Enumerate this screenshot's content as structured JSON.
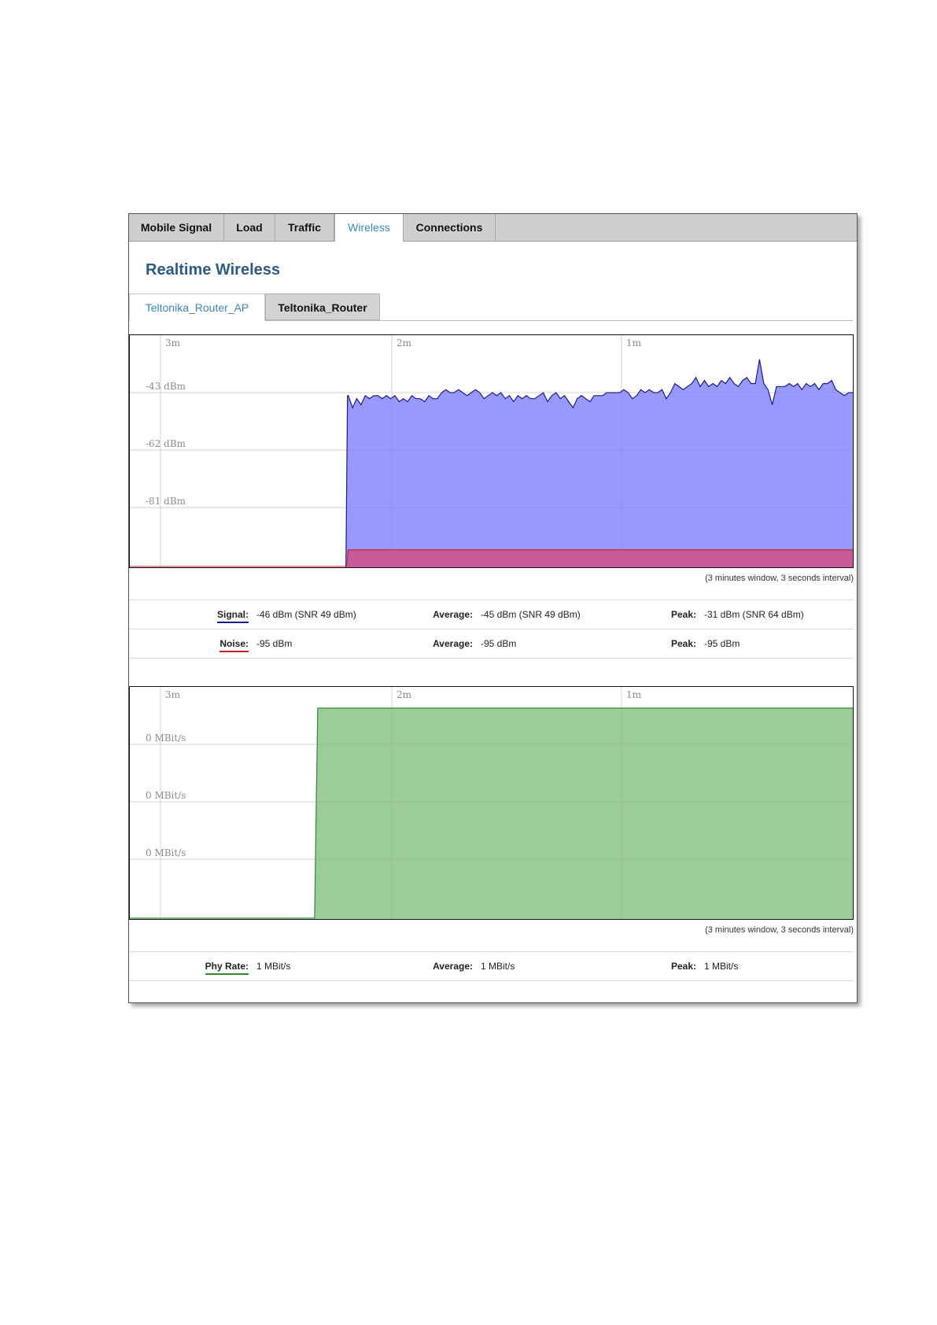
{
  "tabs": [
    {
      "label": "Mobile Signal",
      "active": false
    },
    {
      "label": "Load",
      "active": false
    },
    {
      "label": "Traffic",
      "active": false
    },
    {
      "label": "Wireless",
      "active": true
    },
    {
      "label": "Connections",
      "active": false
    }
  ],
  "page_title": "Realtime Wireless",
  "subtabs": [
    {
      "label": "Teltonika_Router_AP",
      "active": true
    },
    {
      "label": "Teltonika_Router",
      "active": false
    }
  ],
  "colors": {
    "signal_fill": "#9898ff",
    "signal_line": "#1a1a8a",
    "noise_fill": "#c85a98",
    "noise_line": "#c0202a",
    "rate_fill": "#9ccc98",
    "rate_line": "#2e8b2e",
    "grid": "#e6e6e6",
    "tab_active_text": "#3a86b6",
    "title": "#2d5b86"
  },
  "signal_chart": {
    "time_labels": [
      "3m",
      "2m",
      "1m"
    ],
    "y_labels": [
      "-43 dBm",
      "-62 dBm",
      "-81 dBm"
    ],
    "window_note": "(3 minutes window, 3 seconds interval)",
    "stats": [
      {
        "label": "Signal:",
        "value": "-46 dBm (SNR 49 dBm)",
        "avg_label": "Average:",
        "avg_value": "-45 dBm (SNR 49 dBm)",
        "peak_label": "Peak:",
        "peak_value": "-31 dBm (SNR 64 dBm)"
      },
      {
        "label": "Noise:",
        "value": "-95 dBm",
        "avg_label": "Average:",
        "avg_value": "-95 dBm",
        "peak_label": "Peak:",
        "peak_value": "-95 dBm"
      }
    ]
  },
  "rate_chart": {
    "time_labels": [
      "3m",
      "2m",
      "1m"
    ],
    "y_labels": [
      "0 MBit/s",
      "0 MBit/s",
      "0 MBit/s"
    ],
    "window_note": "(3 minutes window, 3 seconds interval)",
    "stats": [
      {
        "label": "Phy Rate:",
        "value": "1 MBit/s",
        "avg_label": "Average:",
        "avg_value": "1 MBit/s",
        "peak_label": "Peak:",
        "peak_value": "1 MBit/s"
      }
    ]
  },
  "chart_data": [
    {
      "type": "area",
      "x_unit": "seconds ago",
      "x_range": [
        180,
        0
      ],
      "series": [
        {
          "name": "Signal",
          "unit": "dBm",
          "start_seconds_ago": 126,
          "values": [
            -44,
            -48,
            -45,
            -47,
            -44,
            -45,
            -44,
            -44,
            -45,
            -44,
            -45,
            -44,
            -46,
            -45,
            -46,
            -44,
            -45,
            -45,
            -46,
            -44,
            -45,
            -45,
            -43,
            -42,
            -43,
            -43,
            -42,
            -43,
            -44,
            -43,
            -42,
            -43,
            -45,
            -44,
            -43,
            -44,
            -43,
            -45,
            -44,
            -46,
            -44,
            -45,
            -44,
            -45,
            -45,
            -44,
            -43,
            -46,
            -44,
            -43,
            -45,
            -44,
            -46,
            -48,
            -45,
            -44,
            -45,
            -46,
            -44,
            -44,
            -44,
            -43,
            -43,
            -43,
            -43,
            -42,
            -43,
            -45,
            -44,
            -42,
            -43,
            -42,
            -43,
            -43,
            -42,
            -45,
            -43,
            -40,
            -41,
            -42,
            -41,
            -40,
            -38,
            -41,
            -39,
            -41,
            -40,
            -41,
            -39,
            -40,
            -38,
            -40,
            -41,
            -39,
            -38,
            -40,
            -40,
            -32,
            -40,
            -42,
            -47,
            -41,
            -41,
            -41,
            -40,
            -41,
            -40,
            -42,
            -40,
            -41,
            -40,
            -42,
            -40,
            -40,
            -39,
            -42,
            -43,
            -44,
            -43,
            -43
          ]
        },
        {
          "name": "Noise",
          "unit": "dBm",
          "start_seconds_ago": 126,
          "values": [
            -95
          ]
        }
      ]
    },
    {
      "type": "area",
      "x_unit": "seconds ago",
      "x_range": [
        180,
        0
      ],
      "series": [
        {
          "name": "Phy Rate",
          "unit": "MBit/s",
          "start_seconds_ago": 134,
          "values": [
            1
          ]
        }
      ]
    }
  ]
}
